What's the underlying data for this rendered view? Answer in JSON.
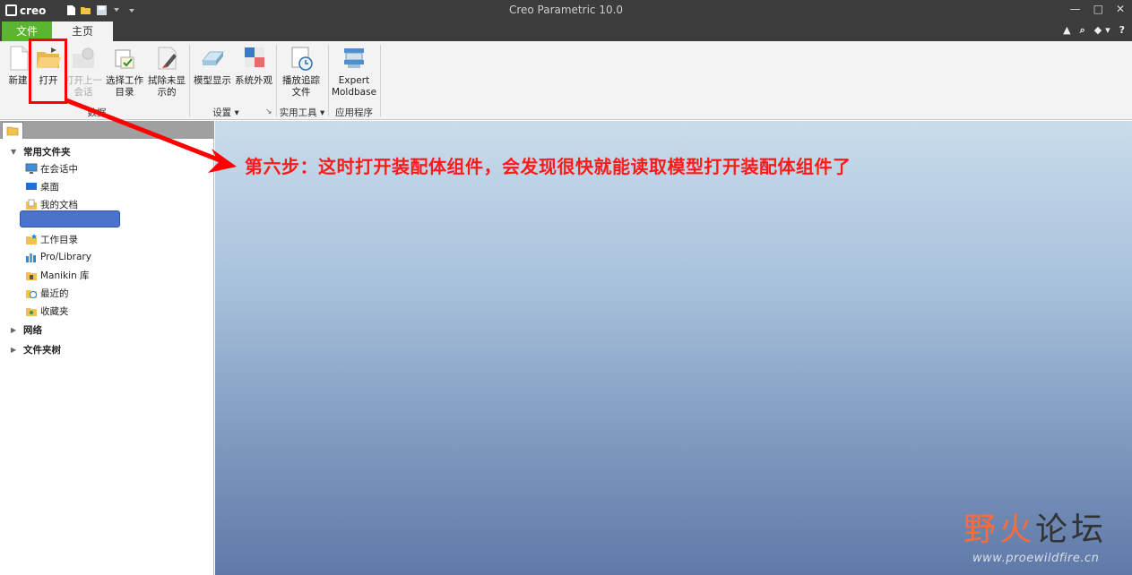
{
  "window": {
    "logo_text": "creo",
    "title": "Creo Parametric 10.0",
    "controls": [
      "—",
      "□",
      "✕"
    ]
  },
  "tabs": {
    "file": "文件",
    "home": "主页",
    "right_icons": [
      "▲",
      "⌕",
      "◆ ▾",
      "?"
    ]
  },
  "ribbon": {
    "new": "新建",
    "open": "打开",
    "open_last": [
      "打开上一",
      "会话"
    ],
    "select_workdir": [
      "选择工作",
      "目录"
    ],
    "erase_undisplayed": [
      "拭除未显",
      "示的"
    ],
    "model_display": "模型显示",
    "system_appearance": "系统外观",
    "play_trail": [
      "播放追踪",
      "文件"
    ],
    "expert_moldbase": [
      "Expert",
      "Moldbase"
    ],
    "groups": {
      "data": "数据",
      "settings": "设置 ▾",
      "utilities": "实用工具 ▾",
      "applications": "应用程序"
    }
  },
  "navigator": {
    "common_folders": "常用文件夹",
    "items": [
      "在会话中",
      "桌面",
      "我的文档",
      "工作目录",
      "Pro/Library",
      "Manikin 库",
      "最近的",
      "收藏夹"
    ],
    "network": "网络",
    "folder_tree": "文件夹树"
  },
  "annotation": "第六步：这时打开装配体组件，会发现很快就能读取模型打开装配体组件了",
  "watermark": {
    "left": "野火",
    "right": "论坛",
    "url": "www.proewildfire.cn"
  },
  "colors": {
    "annotation": "#ff1a1a",
    "file_tab": "#5cb531",
    "selection": "#4a73c9"
  }
}
